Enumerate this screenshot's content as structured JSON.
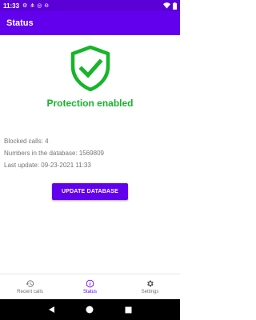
{
  "status_bar": {
    "time": "11:33",
    "icons": [
      "settings-icon",
      "share-icon",
      "signal-off-icon",
      "dnd-icon"
    ],
    "right_icons": [
      "wifi-icon",
      "battery-icon"
    ]
  },
  "app_bar": {
    "title": "Status"
  },
  "main": {
    "shield_color": "#16b52a",
    "protection_text": "Protection enabled",
    "info": {
      "blocked_calls": "Blocked calls: 4",
      "numbers_in_db": "Numbers in the database: 1569809",
      "last_update": "Last update: 09-23-2021 11:33"
    },
    "update_button": "UPDATE DATABASE"
  },
  "bottom_nav": {
    "items": [
      {
        "label": "Recent calls",
        "icon": "history-icon",
        "active": false
      },
      {
        "label": "Status",
        "icon": "info-icon",
        "active": true
      },
      {
        "label": "Settings",
        "icon": "gear-icon",
        "active": false
      }
    ]
  },
  "colors": {
    "primary": "#6200ee",
    "primary_dark": "#5b00d6",
    "success": "#16b52a"
  }
}
